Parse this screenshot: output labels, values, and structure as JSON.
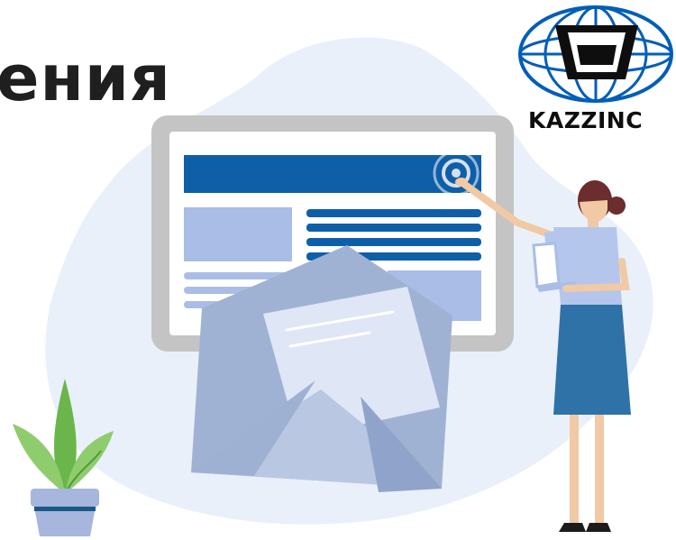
{
  "headline": "ения",
  "logo": {
    "name": "KAZZINC",
    "icon": "globe-mining-cart-icon",
    "color": "#005eb8"
  },
  "illustration": {
    "icons": [
      "web-page-icon",
      "envelope-icon",
      "click-target-icon",
      "woman-figure-icon",
      "laptop-icon",
      "potted-plant-icon"
    ]
  },
  "colors": {
    "background_blob": "#e9f0fa",
    "browser_frame": "#c4c4c4",
    "primary_blue": "#0f5fa8",
    "light_blue": "#a9bde6",
    "envelope": "#a0b2d4",
    "envelope_flap_dark": "#1a5888",
    "letter": "#dfe6f5",
    "plant_green": "#6ab64b",
    "pot": "#a6b6dc",
    "skirt": "#2f72a7",
    "shirt": "#b4c6ec"
  }
}
